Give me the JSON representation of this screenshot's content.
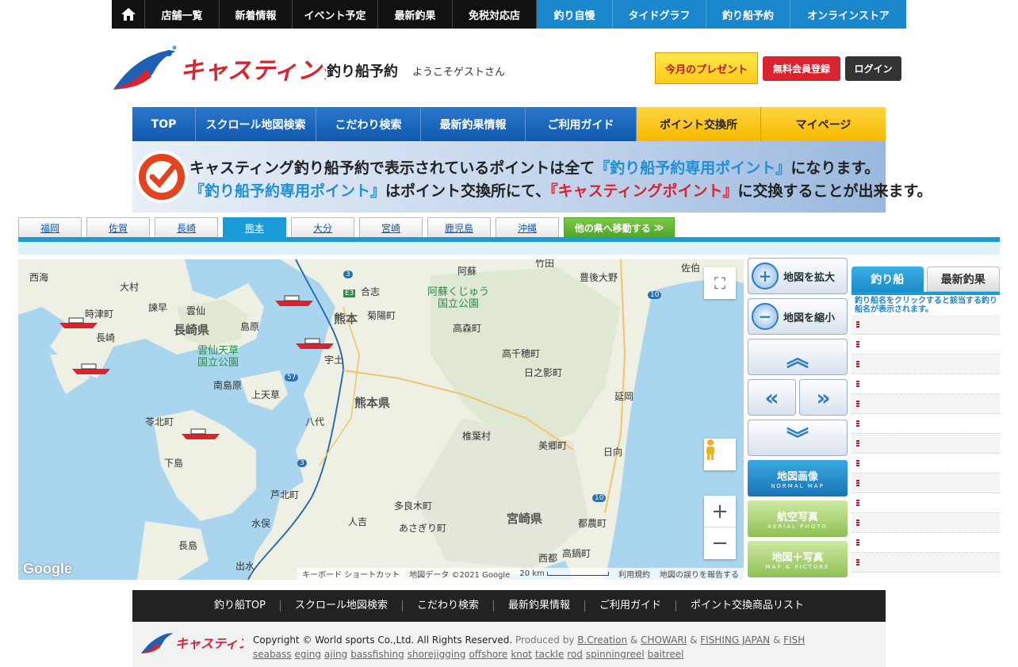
{
  "topbar": {
    "home_icon": "home-icon",
    "items_dark": [
      "店舗一覧",
      "新着情報",
      "イベント予定",
      "最新釣果",
      "免税対応店"
    ],
    "items_blue": [
      "釣り自慢",
      "タイドグラフ",
      "釣り船予約",
      "オンラインストア"
    ]
  },
  "header": {
    "brand": "キャスティング",
    "subtitle": "釣り船予約",
    "welcome": "ようこそゲストさん",
    "present": "今月のプレゼント",
    "register": "無料会員登録",
    "login": "ログイン"
  },
  "mainnav": {
    "items": [
      "TOP",
      "スクロール地図検索",
      "こだわり検索",
      "最新釣果情報",
      "ご利用ガイド"
    ],
    "items_yellow": [
      "ポイント交換所",
      "マイページ"
    ]
  },
  "banner": {
    "line1_a": "キャスティング釣り船予約で表示されているポイントは全て",
    "line1_b": "『釣り船予約専用ポイント』",
    "line1_c": "になります。",
    "line2_a": "『釣り船予約専用ポイント』",
    "line2_b": "はポイント交換所にて、",
    "line2_c": "『キャスティングポイント』",
    "line2_d": "に交換することが出来ます。"
  },
  "prefecture_tabs": {
    "items": [
      "福岡",
      "佐賀",
      "長崎",
      "熊本",
      "大分",
      "宮崎",
      "鹿児島",
      "沖縄"
    ],
    "active": "熊本",
    "other": "他の県へ移動する"
  },
  "map": {
    "labels": {
      "saihai": "西海",
      "omura": "大村",
      "tokitsu": "時津町",
      "isahaya": "諫早",
      "unzen": "雲仙",
      "nagasaki": "長崎",
      "nagasaki_pref": "長崎県",
      "shimabara": "島原",
      "unzen_park": "雲仙天草\n国立公園",
      "minamishimabara": "南島原",
      "kamiamakusa": "上天草",
      "reihoku": "苓北町",
      "shimo": "下島",
      "kumamoto": "熊本",
      "kumamoto_pref": "熊本県",
      "uto": "宇土",
      "yatsushiro": "八代",
      "ashikita": "芦北町",
      "minamata": "水俣",
      "nagashima": "長島",
      "izumi": "出水",
      "hitoyoshi": "人吉",
      "taragi": "多良木町",
      "asagiri": "あさぎり町",
      "koshi": "合志",
      "kikuyo": "菊陽町",
      "aso": "阿蘇",
      "aso_park": "阿蘇くじゅう\n国立公園",
      "takamori": "高森町",
      "takachiho": "高千穂町",
      "hinokage": "日之影町",
      "nobeoka": "延岡",
      "shiiba": "椎葉村",
      "misato": "美郷町",
      "hyuga": "日向",
      "miyazaki_pref": "宮崎県",
      "tsuno": "都農町",
      "nishimera": "西都",
      "takanabe": "高鍋町",
      "bungoono": "豊後大野",
      "saiki": "佐伯",
      "taketa": "竹田",
      "route3": "3",
      "route57": "57",
      "routeE3": "E3",
      "route10": "10"
    },
    "google": "Google",
    "footer": {
      "keyboard": "キーボード ショートカット",
      "data": "地図データ ©2021 Google",
      "scale": "20 km",
      "terms": "利用規約",
      "report": "地図の誤りを報告する"
    },
    "fullscreen_icon": "fullscreen-icon",
    "pegman_icon": "pegman-icon",
    "zoom_in": "+",
    "zoom_out": "−"
  },
  "controls": {
    "zoom_in": "地図を拡大",
    "zoom_out": "地図を縮小",
    "map_normal": "地図画像",
    "map_normal_sub": "NORMAL MAP",
    "map_aerial": "航空写真",
    "map_aerial_sub": "AERIAL PHOTO",
    "map_both": "地図＋写真",
    "map_both_sub": "MAP & PICTURE"
  },
  "side": {
    "tab_boat": "釣り船",
    "tab_result": "最新釣果",
    "note": "釣り船名をクリックすると該当する釣り船名が表示されます。",
    "row_count": 13
  },
  "footer": {
    "nav": [
      "釣り船TOP",
      "スクロール地図検索",
      "こだわり検索",
      "最新釣果情報",
      "ご利用ガイド",
      "ポイント交換商品リスト"
    ],
    "copyright": "Copyright © World sports Co.,Ltd. All Rights Reserved.",
    "produced_by": "Produced by",
    "b_creation": "B.Creation",
    "amp": "&",
    "chowari": "CHOWARI",
    "fishing_japan": "FISHING JAPAN",
    "fish": "FISH",
    "tags": [
      "seabass",
      "eging",
      "ajing",
      "bassfishing",
      "shorejigging",
      "offshore",
      "knot",
      "tackle",
      "rod",
      "spinningreel",
      "baitreel"
    ]
  },
  "colors": {
    "blue": "#1a86cc",
    "navy": "#0f58ad",
    "yellow": "#f8b800",
    "red": "#d9232e",
    "black": "#111111"
  }
}
